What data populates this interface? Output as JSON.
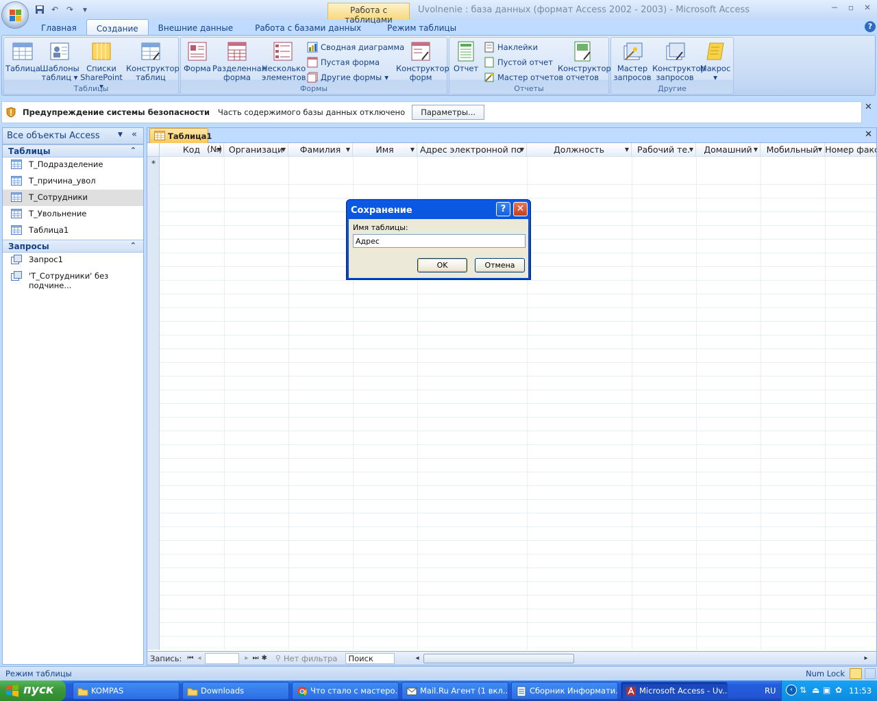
{
  "window": {
    "title": "Uvolnenie : база данных (формат Access 2002 - 2003)  -  Microsoft Access",
    "context_tab": "Работа с таблицами"
  },
  "ribbon_tabs": [
    "Главная",
    "Создание",
    "Внешние данные",
    "Работа с базами данных",
    "Режим таблицы"
  ],
  "ribbon": {
    "tables": {
      "label": "Таблицы",
      "table": "Таблица",
      "templates_l1": "Шаблоны",
      "templates_l2": "таблиц",
      "sharepoint_l1": "Списки",
      "sharepoint_l2": "SharePoint",
      "designer_l1": "Конструктор",
      "designer_l2": "таблиц"
    },
    "forms": {
      "label": "Формы",
      "form": "Форма",
      "split_l1": "Разделенная",
      "split_l2": "форма",
      "multi_l1": "Несколько",
      "multi_l2": "элементов",
      "pivot": "Сводная диаграмма",
      "blank": "Пустая форма",
      "other": "Другие формы",
      "designer_l1": "Конструктор",
      "designer_l2": "форм"
    },
    "reports": {
      "label": "Отчеты",
      "report": "Отчет",
      "labels": "Наклейки",
      "blank": "Пустой отчет",
      "wizard": "Мастер отчетов",
      "designer_l1": "Конструктор",
      "designer_l2": "отчетов"
    },
    "other": {
      "label": "Другие",
      "query_wizard_l1": "Мастер",
      "query_wizard_l2": "запросов",
      "query_designer_l1": "Конструктор",
      "query_designer_l2": "запросов",
      "macro": "Макрос"
    }
  },
  "security": {
    "title": "Предупреждение системы безопасности",
    "text": "Часть содержимого базы данных отключено",
    "button": "Параметры..."
  },
  "nav": {
    "header": "Все объекты Access",
    "tables_section": "Таблицы",
    "tables": [
      "Т_Подразделение",
      "Т_причина_увол",
      "Т_Сотрудники",
      "Т_Увольнение",
      "Таблица1"
    ],
    "queries_section": "Запросы",
    "queries": [
      "Запрос1",
      "'Т_Сотрудники' без подчине..."
    ]
  },
  "document": {
    "tab": "Таблица1",
    "columns": [
      "Код",
      "Организаци",
      "Фамилия",
      "Имя",
      "Адрес электронной по",
      "Должность",
      "Рабочий те.",
      "Домашний",
      "Мобильный",
      "Номер факс"
    ],
    "new_row_marker": "*",
    "new_row_value": "(№)",
    "navbar": {
      "record_label": "Запись:",
      "filter": "Нет фильтра",
      "search": "Поиск"
    }
  },
  "dialog": {
    "title": "Сохранение",
    "label": "Имя таблицы:",
    "value": "Адрес",
    "ok": "OK",
    "cancel": "Отмена"
  },
  "status": {
    "left": "Режим таблицы",
    "right": "Num Lock"
  },
  "taskbar": {
    "start": "пуск",
    "items": [
      "KOMPAS",
      "Downloads",
      "Что стало с мастеро...",
      "Mail.Ru Агент (1 вкл...",
      "Сборник Информати...",
      "Microsoft Access - Uv..."
    ],
    "lang": "RU",
    "time": "11:53"
  }
}
